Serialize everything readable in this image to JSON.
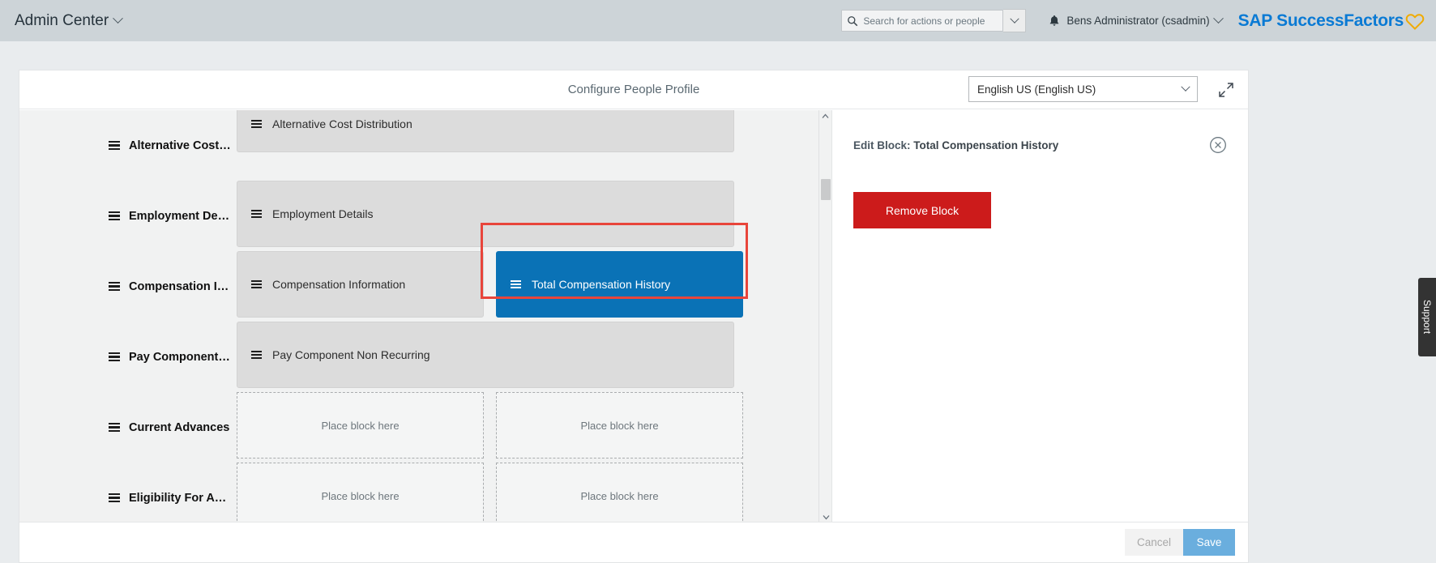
{
  "header": {
    "app_menu_label": "Admin Center",
    "search": {
      "placeholder": "Search for actions or people",
      "value": "",
      "icon": "search-icon"
    },
    "notifications_icon": "bell-icon",
    "user_label": "Bens Administrator (csadmin)",
    "logo_text": "SAP SuccessFactors",
    "logo_heart_color": "#f0ab00",
    "logo_text_color": "#0a7ad4",
    "header_bg": "#cdd4d8"
  },
  "page": {
    "title": "Configure People Profile",
    "language_select": {
      "value": "English US (English US)",
      "chevron": "chevron-down-icon"
    },
    "expand_icon": "expand-fullscreen-icon"
  },
  "builder": {
    "rows": [
      {
        "label": "Alternative Cost…",
        "cells": [
          {
            "type": "block",
            "label": "Alternative Cost Distribution",
            "width": "full",
            "selected": false
          }
        ]
      },
      {
        "label": "Employment De…",
        "cells": [
          {
            "type": "block",
            "label": "Employment Details",
            "width": "full",
            "selected": false
          }
        ]
      },
      {
        "label": "Compensation I…",
        "cells": [
          {
            "type": "block",
            "label": "Compensation Information",
            "width": "half",
            "selected": false
          },
          {
            "type": "block",
            "label": "Total Compensation History",
            "width": "half",
            "selected": true
          }
        ]
      },
      {
        "label": "Pay Component…",
        "cells": [
          {
            "type": "block",
            "label": "Pay Component Non Recurring",
            "width": "full",
            "selected": false
          }
        ]
      },
      {
        "label": "Current Advances",
        "cells": [
          {
            "type": "empty",
            "label": "Place block here",
            "width": "half",
            "selected": false
          },
          {
            "type": "empty",
            "label": "Place block here",
            "width": "half",
            "selected": false
          }
        ]
      },
      {
        "label": "Eligibility For A…",
        "cells": [
          {
            "type": "empty",
            "label": "Place block here",
            "width": "half",
            "selected": false
          },
          {
            "type": "empty",
            "label": "Place block here",
            "width": "half",
            "selected": false
          }
        ]
      }
    ],
    "selection_outline_color": "#e8453b",
    "selected_block_color": "#0a72b6",
    "drag_handle_icon": "hamburger-drag-handle-icon",
    "scrollbar": {
      "up_arrow_icon": "chevron-up-icon",
      "down_arrow_icon": "chevron-down-icon"
    }
  },
  "edit_panel": {
    "title_prefix": "Edit Block:",
    "block_name": "Total Compensation History",
    "close_icon": "close-circle-icon",
    "remove_button_label": "Remove Block",
    "remove_button_color": "#cc1b1b"
  },
  "footer": {
    "cancel_label": "Cancel",
    "save_label": "Save",
    "save_color": "#6aaede"
  },
  "support": {
    "label": "Support"
  }
}
